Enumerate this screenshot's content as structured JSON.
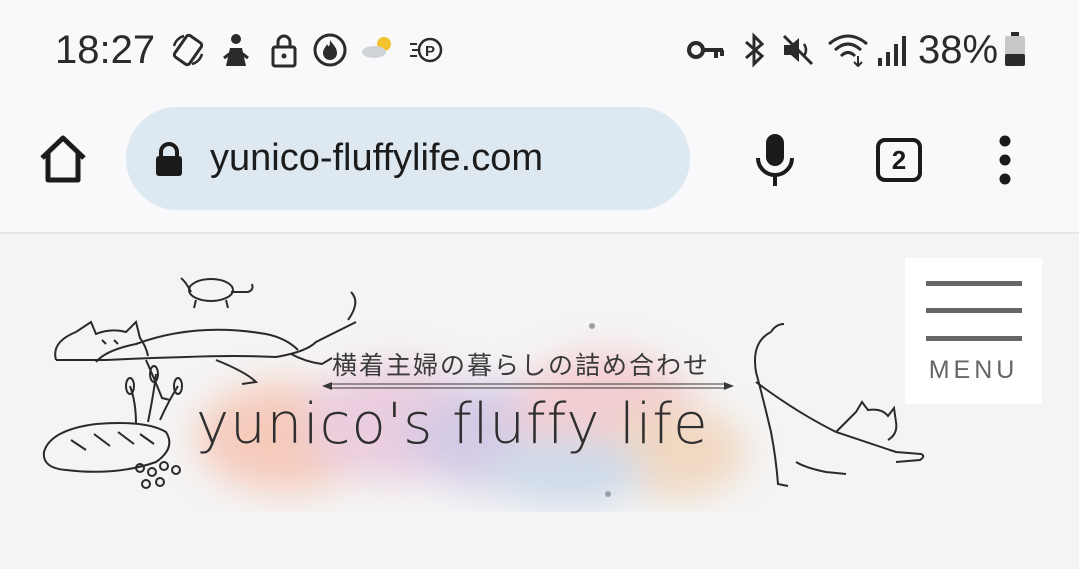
{
  "status_bar": {
    "time": "18:27",
    "battery": "38%",
    "left_icons": [
      "rotate-icon",
      "person-icon",
      "lock-icon",
      "fire-icon",
      "weather-icon",
      "parking-icon"
    ],
    "right_icons": [
      "key-icon",
      "bluetooth-icon",
      "mute-icon",
      "wifi-icon",
      "signal-icon",
      "battery-icon"
    ]
  },
  "browser": {
    "url": "yunico-fluffylife.com",
    "tab_count": "2"
  },
  "site": {
    "tagline": "横着主婦の暮らしの詰め合わせ",
    "title": "yunico's fluffy life",
    "menu_label": "MENU"
  },
  "colors": {
    "url_bar": "#dde8f0",
    "background": "#f4f4f4"
  }
}
